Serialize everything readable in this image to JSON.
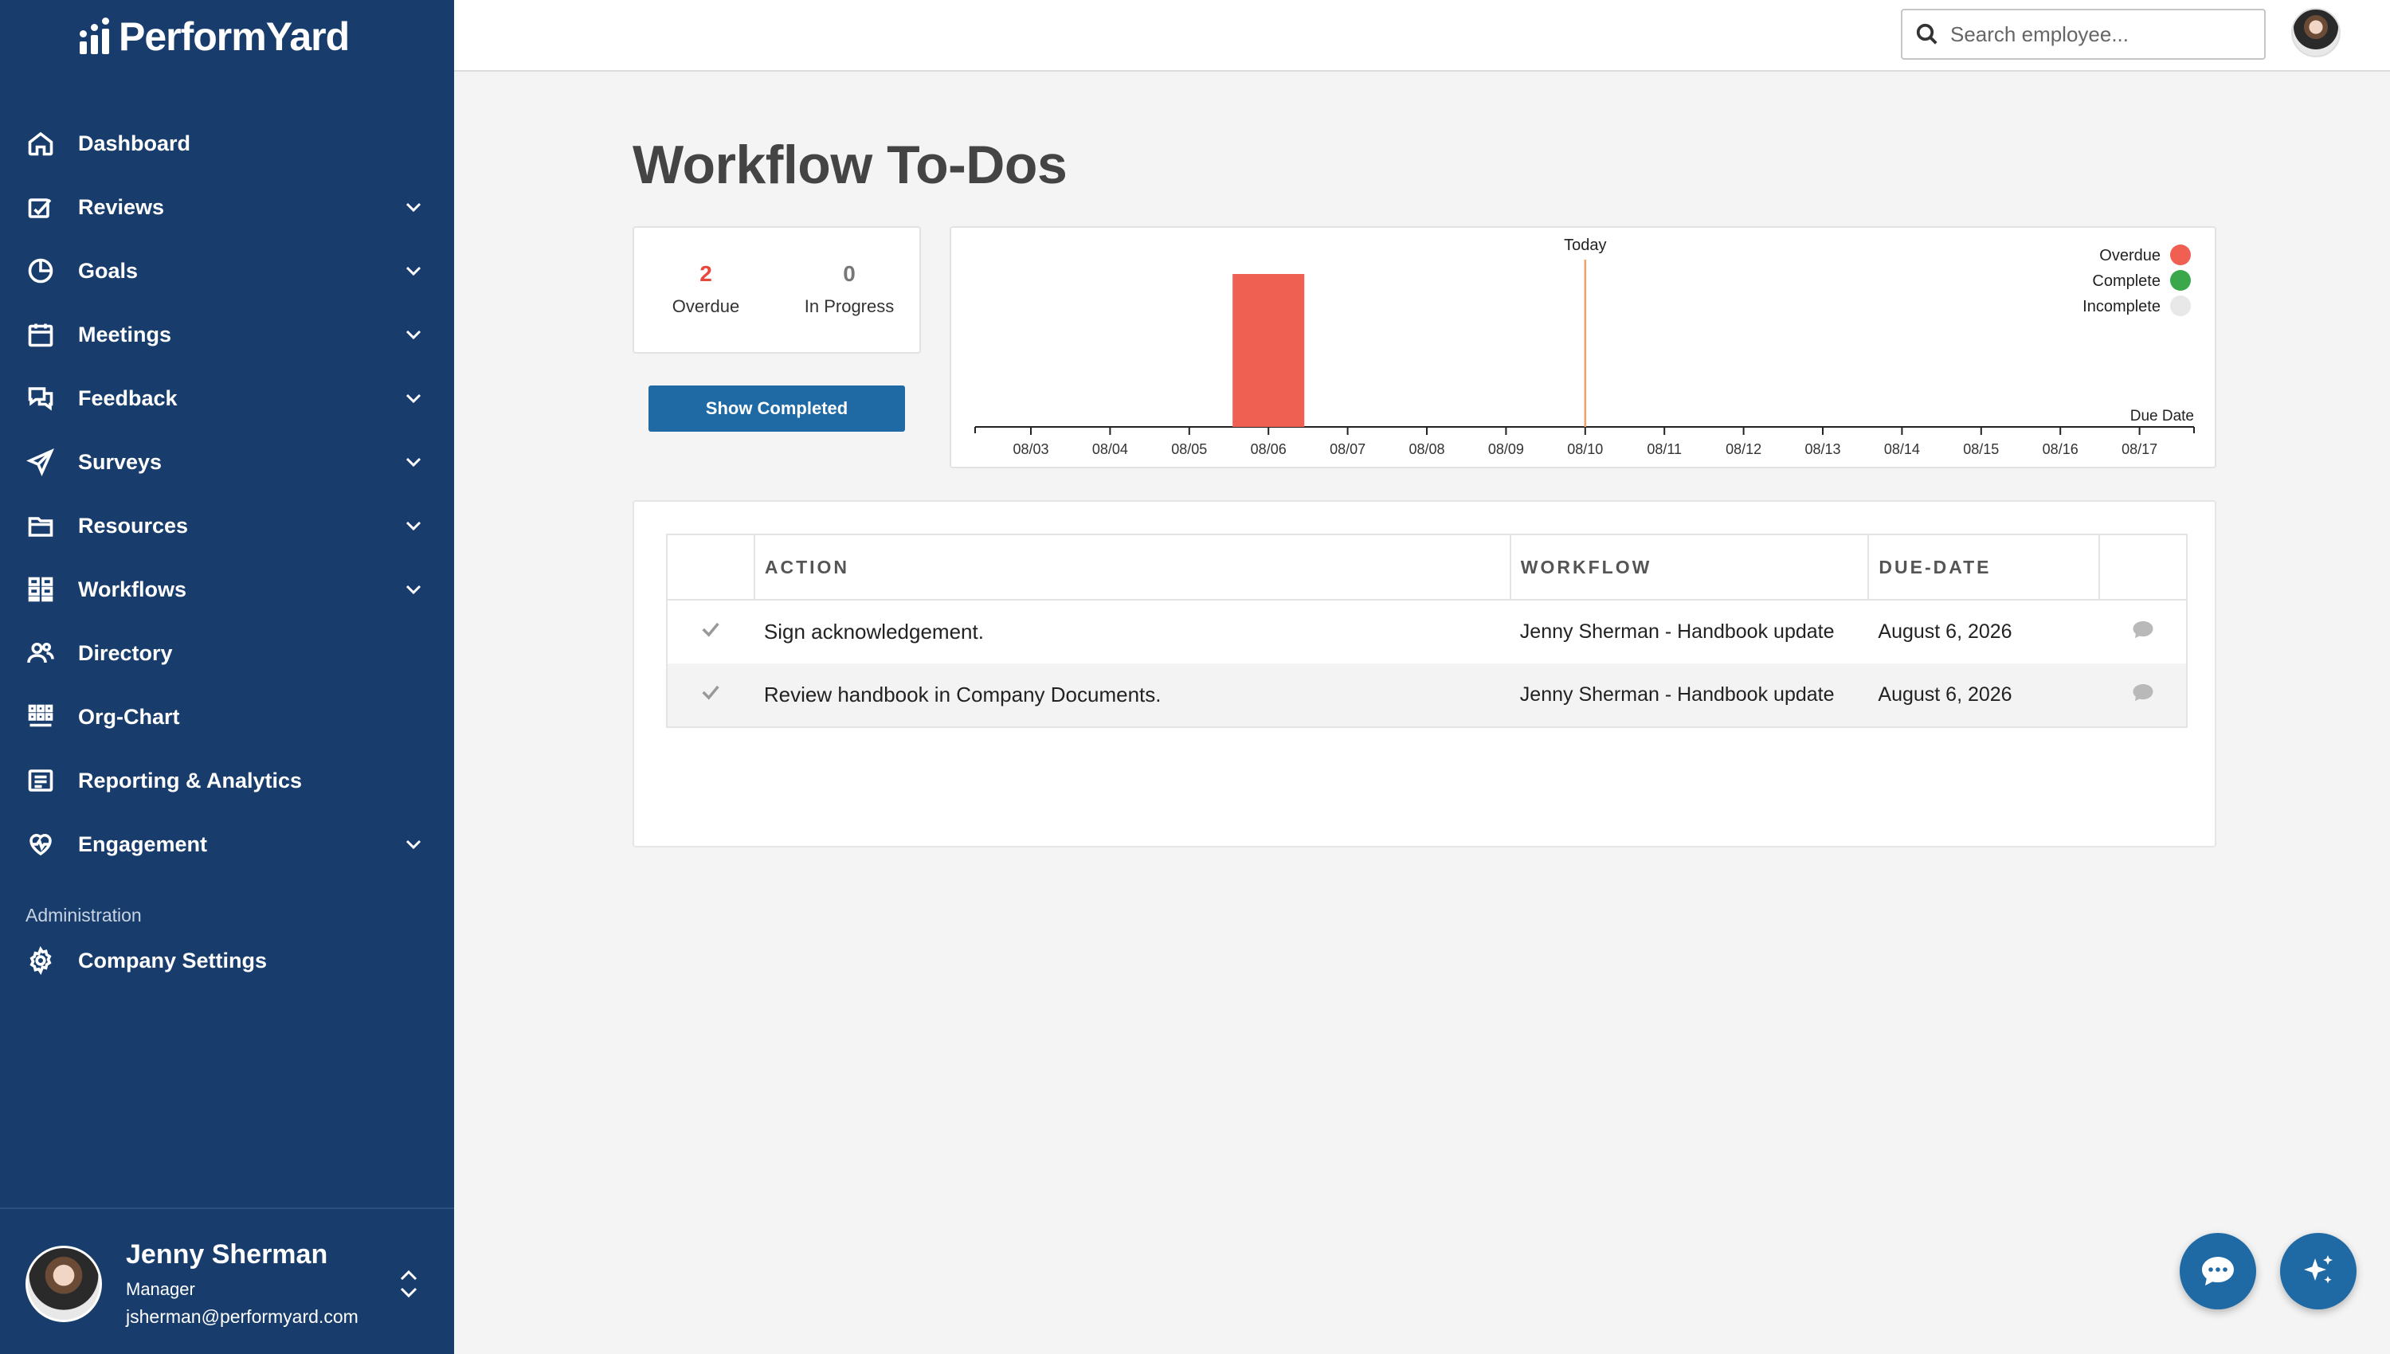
{
  "brand": {
    "name": "PerformYard"
  },
  "nav": {
    "items": [
      {
        "label": "Dashboard",
        "icon": "home-icon",
        "expandable": false
      },
      {
        "label": "Reviews",
        "icon": "review-icon",
        "expandable": true
      },
      {
        "label": "Goals",
        "icon": "pie-chart-icon",
        "expandable": true
      },
      {
        "label": "Meetings",
        "icon": "calendar-icon",
        "expandable": true
      },
      {
        "label": "Feedback",
        "icon": "chat-bubbles-icon",
        "expandable": true
      },
      {
        "label": "Surveys",
        "icon": "paper-plane-icon",
        "expandable": true
      },
      {
        "label": "Resources",
        "icon": "folder-icon",
        "expandable": true
      },
      {
        "label": "Workflows",
        "icon": "workflow-icon",
        "expandable": true
      },
      {
        "label": "Directory",
        "icon": "people-icon",
        "expandable": false
      },
      {
        "label": "Org-Chart",
        "icon": "org-chart-icon",
        "expandable": false
      },
      {
        "label": "Reporting & Analytics",
        "icon": "report-icon",
        "expandable": false
      },
      {
        "label": "Engagement",
        "icon": "heart-pulse-icon",
        "expandable": true
      }
    ],
    "admin_label": "Administration",
    "company_settings": "Company Settings"
  },
  "profile": {
    "name": "Jenny Sherman",
    "role": "Manager",
    "email": "jsherman@performyard.com"
  },
  "search": {
    "placeholder": "Search employee..."
  },
  "page": {
    "title": "Workflow To-Dos"
  },
  "stats": {
    "overdue": {
      "value": "2",
      "label": "Overdue",
      "color": "#e8473c"
    },
    "in_progress": {
      "value": "0",
      "label": "In Progress",
      "color": "#777777"
    }
  },
  "show_completed_label": "Show Completed",
  "chart_data": {
    "type": "bar",
    "categories": [
      "08/03",
      "08/04",
      "08/05",
      "08/06",
      "08/07",
      "08/08",
      "08/09",
      "08/10",
      "08/11",
      "08/12",
      "08/13",
      "08/14",
      "08/15",
      "08/16",
      "08/17"
    ],
    "series": [
      {
        "name": "Overdue",
        "color": "#ef5f52",
        "values": [
          0,
          0,
          0,
          2,
          0,
          0,
          0,
          0,
          0,
          0,
          0,
          0,
          0,
          0,
          0
        ]
      },
      {
        "name": "Complete",
        "color": "#3aa84a",
        "values": [
          0,
          0,
          0,
          0,
          0,
          0,
          0,
          0,
          0,
          0,
          0,
          0,
          0,
          0,
          0
        ]
      },
      {
        "name": "Incomplete",
        "color": "#e8e8e8",
        "values": [
          0,
          0,
          0,
          0,
          0,
          0,
          0,
          0,
          0,
          0,
          0,
          0,
          0,
          0,
          0
        ]
      }
    ],
    "today_marker": {
      "label": "Today",
      "category": "08/10",
      "color": "#f4a06a"
    },
    "xlabel": "Due Date",
    "legend": "top-right",
    "grid": false
  },
  "table": {
    "headers": {
      "action": "ACTION",
      "workflow": "WORKFLOW",
      "due_date": "DUE-DATE"
    },
    "rows": [
      {
        "action": "Sign acknowledgement.",
        "workflow": "Jenny Sherman - Handbook update",
        "due_date": "August 6, 2026"
      },
      {
        "action": "Review handbook in Company Documents.",
        "workflow": "Jenny Sherman - Handbook update",
        "due_date": "August 6, 2026"
      }
    ]
  }
}
